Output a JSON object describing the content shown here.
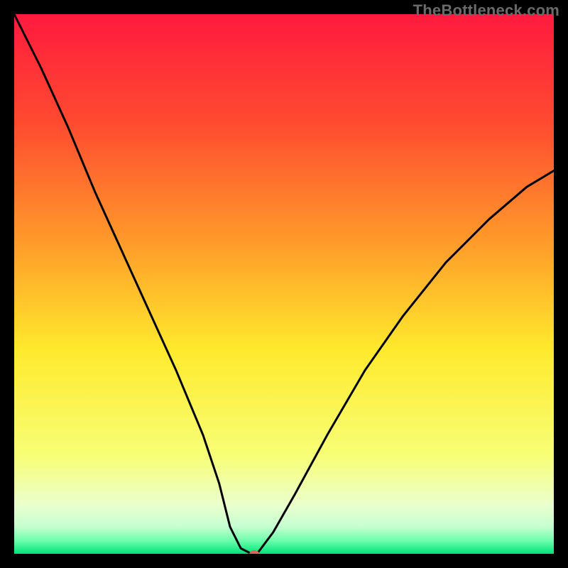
{
  "watermark": "TheBottleneck.com",
  "chart_data": {
    "type": "line",
    "title": "",
    "xlabel": "",
    "ylabel": "",
    "xlim": [
      0,
      100
    ],
    "ylim": [
      0,
      100
    ],
    "x": [
      0,
      5,
      10,
      15,
      20,
      25,
      30,
      35,
      38,
      40,
      42,
      44,
      45,
      48,
      52,
      58,
      65,
      72,
      80,
      88,
      95,
      100
    ],
    "values": [
      100,
      90,
      79,
      67,
      56,
      45,
      34,
      22,
      13,
      5,
      1,
      0,
      0,
      4,
      11,
      22,
      34,
      44,
      54,
      62,
      68,
      71
    ],
    "marker": {
      "x": 44.5,
      "y": 0
    },
    "gradient_stops": [
      {
        "offset": 0.0,
        "color": "#ff1a3e"
      },
      {
        "offset": 0.2,
        "color": "#ff4a30"
      },
      {
        "offset": 0.42,
        "color": "#ff9a2a"
      },
      {
        "offset": 0.62,
        "color": "#ffe92c"
      },
      {
        "offset": 0.82,
        "color": "#f7ff77"
      },
      {
        "offset": 0.91,
        "color": "#eaffce"
      },
      {
        "offset": 0.95,
        "color": "#c6ffd0"
      },
      {
        "offset": 0.975,
        "color": "#6fffad"
      },
      {
        "offset": 1.0,
        "color": "#00e37a"
      }
    ],
    "marker_color": "#d16a5a",
    "curve_color": "#000000"
  }
}
